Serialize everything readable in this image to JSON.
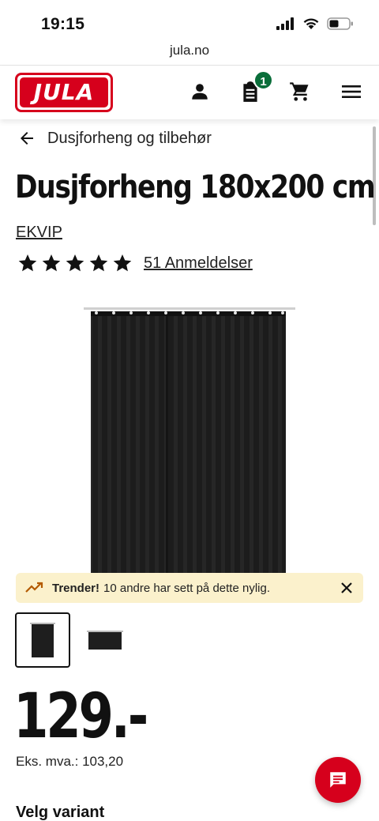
{
  "status_bar": {
    "time": "19:15"
  },
  "browser": {
    "url": "jula.no"
  },
  "header": {
    "logo_text": "JULA",
    "cart_count": "1",
    "brand_color": "#d6001c",
    "badge_color": "#0a6e3a"
  },
  "breadcrumb": {
    "label": "Dusjforheng og tilbehør"
  },
  "product": {
    "title": "Dusjforheng 180x200 cm",
    "brand": "EKVIP",
    "rating_stars": 5,
    "reviews_label": "51 Anmeldelser"
  },
  "trending": {
    "strong": "Trender!",
    "text": "10 andre har sett på dette nylig.",
    "background": "#fbf1cc"
  },
  "pricing": {
    "price": "129.-",
    "ex_vat": "Eks. mva.: 103,20"
  },
  "variant": {
    "title": "Velg variant"
  }
}
